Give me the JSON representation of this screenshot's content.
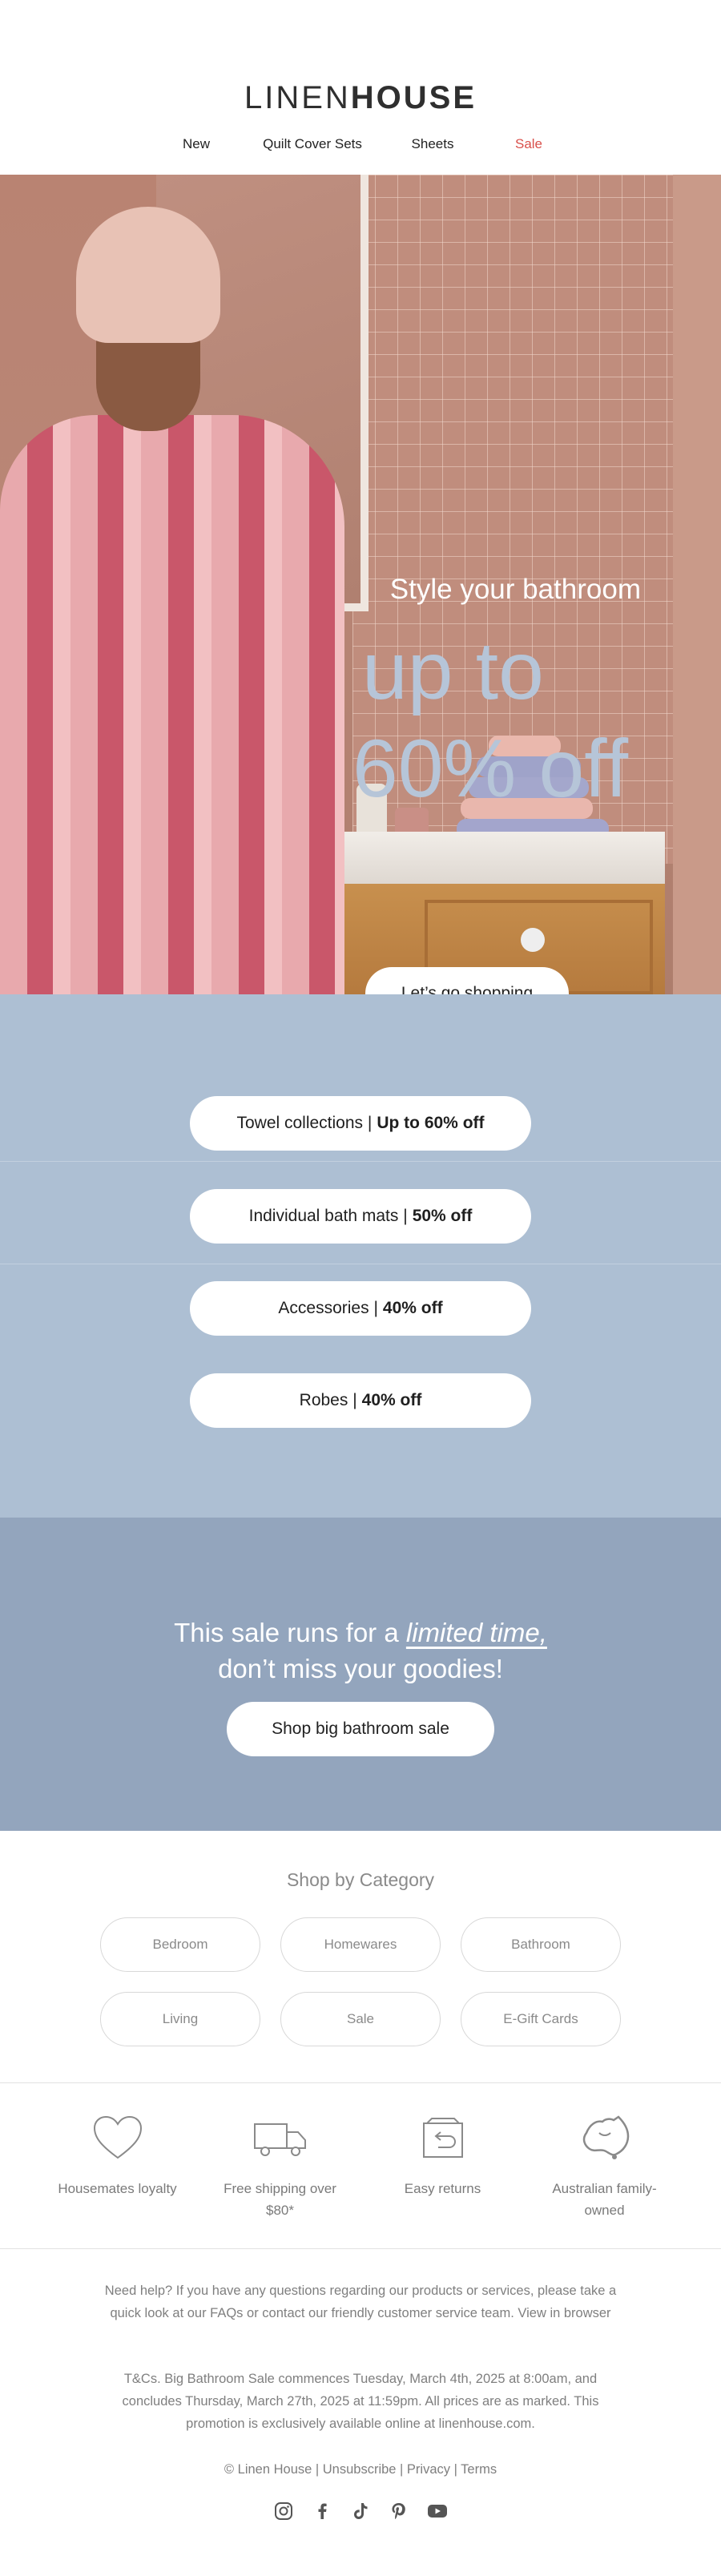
{
  "brand": {
    "logo_light": "LINEN",
    "logo_bold": "HOUSE"
  },
  "nav": [
    {
      "label": "New"
    },
    {
      "label": "Quilt Cover Sets"
    },
    {
      "label": "Sheets"
    },
    {
      "label": "Sale"
    }
  ],
  "hero": {
    "subtitle": "Style your bathroom",
    "headline_1": "up to",
    "headline_2": "60% off",
    "cta": "Let’s go shopping"
  },
  "offers": [
    {
      "name": "Towel collections |",
      "discount": "Up to 60% off"
    },
    {
      "name": "Individual bath mats |",
      "discount": "50% off"
    },
    {
      "name": "Accessories |",
      "discount": "40% off"
    },
    {
      "name": "Robes |",
      "discount": "40% off"
    }
  ],
  "limited": {
    "line1_prefix": "This sale runs for a",
    "line1_emphasis": "limited time,",
    "line2": "don’t miss your goodies!",
    "cta": "Shop big bathroom sale"
  },
  "categories": {
    "title": "Shop by Category",
    "items": [
      "Bedroom",
      "Homewares",
      "Bathroom",
      "Living",
      "Sale",
      "E-Gift Cards"
    ]
  },
  "features": [
    {
      "icon": "heart-icon",
      "label": "Housemates loyalty"
    },
    {
      "icon": "truck-icon",
      "label": "Free shipping over $80*"
    },
    {
      "icon": "return-box-icon",
      "label": "Easy returns"
    },
    {
      "icon": "australia-icon",
      "label": "Australian family-owned"
    }
  ],
  "footer": {
    "help": "Need help? If you have any questions regarding our products or services, please take a quick look at our FAQs or contact our friendly customer service team. View in browser",
    "tcs": "T&Cs. Big Bathroom Sale commences Tuesday, March 4th, 2025 at 8:00am, and concludes Thursday, March 27th, 2025 at 11:59pm. All prices are as marked. This promotion is exclusively available online at linenhouse.com.",
    "legal": "© Linen House | Unsubscribe | Privacy | Terms",
    "socials": [
      "instagram-icon",
      "facebook-icon",
      "tiktok-icon",
      "pinterest-icon",
      "youtube-icon"
    ]
  },
  "colors": {
    "sale_red": "#d9504b",
    "offers_bg": "#adbfd3",
    "limited_bg": "#93a5bd",
    "hero_headline": "#b6c5d8"
  }
}
